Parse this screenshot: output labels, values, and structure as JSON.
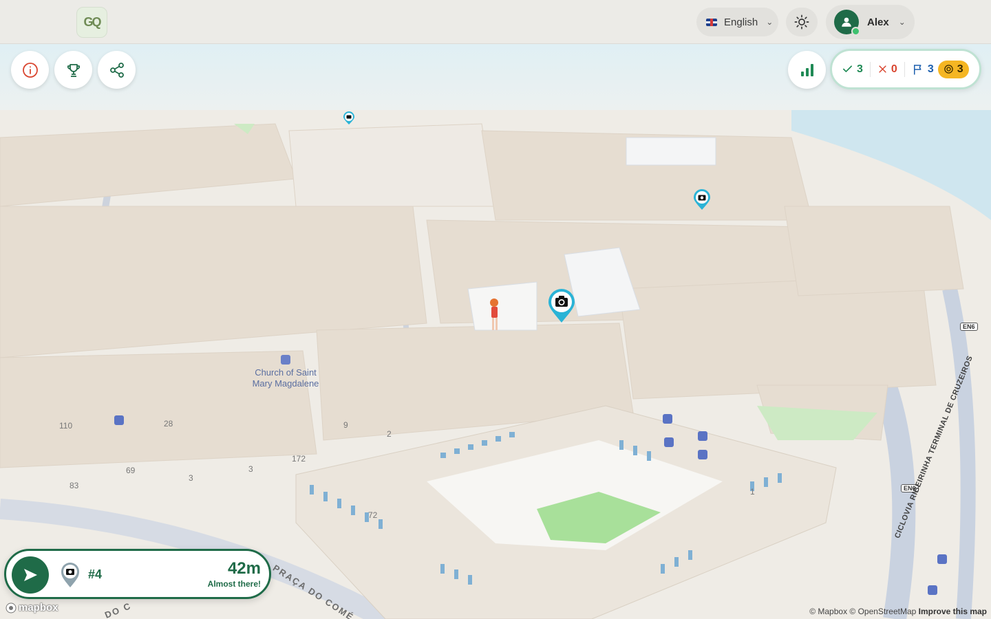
{
  "app": {
    "logo_text": "GQ"
  },
  "header": {
    "language_label": "English",
    "language_flag": "uk-flag-icon",
    "theme_icon": "sun-icon",
    "user_name": "Alex"
  },
  "left_toolbar": [
    {
      "name": "info-button",
      "icon": "info-icon"
    },
    {
      "name": "leaderboard-button",
      "icon": "trophy-icon"
    },
    {
      "name": "share-button",
      "icon": "share-icon"
    }
  ],
  "stats_button": {
    "icon": "bar-chart-icon"
  },
  "score": {
    "correct": "3",
    "wrong": "0",
    "flags": "3",
    "coins": "3"
  },
  "navigation": {
    "target_number": "#4",
    "distance": "42m",
    "status": "Almost there!"
  },
  "map": {
    "poi_church": "Church of Saint Mary Magdalene",
    "street_praca": "PRAÇA DO COMÉ",
    "street_do": "DO C",
    "street_ciclovia": "CICLOVIA RIBEIRINHA TERMINAL DE CRUZEIROS",
    "road_en6_a": "EN6",
    "road_en6_b": "EN6",
    "numbers": [
      "110",
      "28",
      "9",
      "2",
      "69",
      "83",
      "3",
      "3",
      "172",
      "72",
      "1"
    ],
    "brand": "mapbox",
    "attribution": "© Mapbox © OpenStreetMap",
    "improve": "Improve this map"
  },
  "colors": {
    "brand_green": "#1f6b48",
    "coin_yellow": "#f5b623",
    "correct_green": "#1f8a55",
    "wrong_red": "#d9452f",
    "flag_blue": "#1c5fae",
    "pin_cyan": "#2ab3d6"
  }
}
